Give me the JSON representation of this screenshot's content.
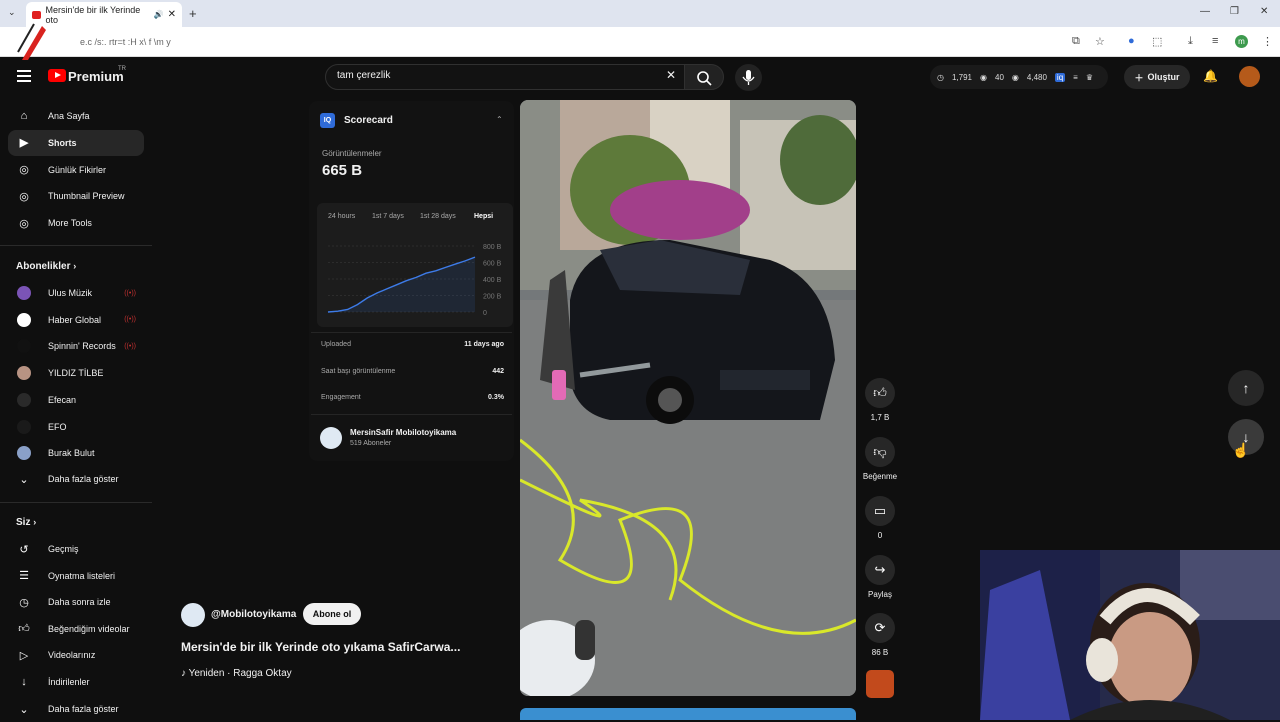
{
  "browser": {
    "tab_title": "Mersin'de bir ilk Yerinde oto",
    "new_tab": "+",
    "close_tab": "✕",
    "minimize": "—",
    "restore": "❐",
    "close_window": "✕",
    "address": "e.c /s:. rtr=t :H x\\ f \\m y",
    "profile_initial": "m"
  },
  "header": {
    "logo_text": "Premium",
    "logo_region": "TR",
    "search_value": "tam çerezlik",
    "stats": {
      "views": "1,791",
      "likes": "40",
      "eye": "4,480"
    },
    "create_label": "Oluştur"
  },
  "sidebar": {
    "main_items": [
      {
        "label": "Ana Sayfa",
        "icon": "home-icon"
      },
      {
        "label": "Shorts",
        "icon": "shorts-icon"
      },
      {
        "label": "Günlük Fikirler",
        "icon": "tool-icon"
      },
      {
        "label": "Thumbnail Preview",
        "icon": "tool-icon"
      },
      {
        "label": "More Tools",
        "icon": "tool-icon"
      }
    ],
    "subscriptions_title": "Abonelikler",
    "subscriptions": [
      {
        "label": "Ulus Müzik",
        "color": "#7b54b6",
        "live": true
      },
      {
        "label": "Haber Global",
        "color": "#ffffff",
        "live": true
      },
      {
        "label": "Spinnin' Records",
        "color": "#111111",
        "live": true
      },
      {
        "label": "YILDIZ TİLBE",
        "color": "#b89383",
        "live": false
      },
      {
        "label": "Efecan",
        "color": "#2a2a2a",
        "live": false
      },
      {
        "label": "EFO",
        "color": "#1a1a1a",
        "live": false
      },
      {
        "label": "Burak Bulut",
        "color": "#8aa0c8",
        "live": false
      }
    ],
    "show_more_1": "Daha fazla göster",
    "you_title": "Siz",
    "you_items": [
      {
        "label": "Geçmiş",
        "icon": "history-icon"
      },
      {
        "label": "Oynatma listeleri",
        "icon": "playlist-icon"
      },
      {
        "label": "Daha sonra izle",
        "icon": "clock-icon"
      },
      {
        "label": "Beğendiğim videolar",
        "icon": "like-icon"
      },
      {
        "label": "Videolarınız",
        "icon": "video-icon"
      },
      {
        "label": "İndirilenler",
        "icon": "download-icon"
      }
    ],
    "show_more_2": "Daha fazla göster"
  },
  "scorecard": {
    "title": "Scorecard",
    "views_label": "Görüntülenmeler",
    "views_value": "665 B",
    "ranges": [
      "24 hours",
      "1st 7 days",
      "1st 28 days",
      "Hepsi"
    ],
    "active_range": "Hepsi",
    "rows": [
      {
        "label": "Uploaded",
        "value": "11 days ago"
      },
      {
        "label": "Saat başı görüntülenme",
        "value": "442"
      },
      {
        "label": "Engagement",
        "value": "0.3%"
      }
    ],
    "channel_name": "MersinSafir Mobilotoyikama",
    "channel_subs": "519 Aboneler"
  },
  "chart_data": {
    "type": "line",
    "title": "",
    "ylim": [
      0,
      800
    ],
    "yticks": [
      "800 B",
      "600 B",
      "400 B",
      "200 B",
      "0"
    ],
    "ytick_values": [
      800,
      600,
      400,
      200,
      0
    ],
    "series": [
      {
        "values": [
          0,
          10,
          30,
          90,
          170,
          230,
          280,
          330,
          380,
          420,
          470,
          500,
          540,
          580,
          620,
          665
        ]
      }
    ],
    "color": "#3d7be8"
  },
  "actions": {
    "like_count": "1,7 B",
    "dislike_label": "Beğenme",
    "comment_count": "0",
    "share_label": "Paylaş",
    "remix_count": "86 B"
  },
  "video_info": {
    "channel_handle": "@Mobilotoyikama",
    "subscribe_label": "Abone ol",
    "title": "Mersin'de bir ilk Yerinde oto yıkama SafirCarwa...",
    "music": "♪ Yeniden · Ragga Oktay"
  }
}
